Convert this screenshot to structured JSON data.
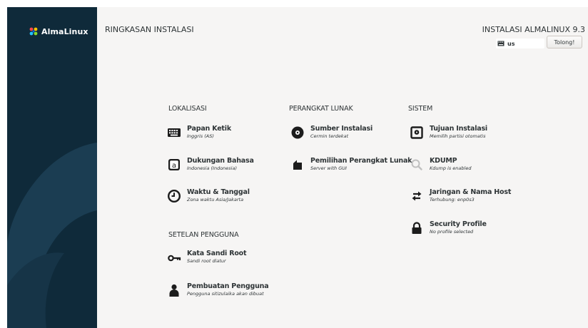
{
  "sidebar": {
    "logo_text": "AlmaLinux"
  },
  "header": {
    "page_title": "RINGKASAN INSTALASI",
    "product_title": "INSTALASI ALMALINUX 9.3",
    "keyboard_layout": "us",
    "help_label": "Tolong!"
  },
  "categories": {
    "localization": "LOKALISASI",
    "software": "PERANGKAT LUNAK",
    "system": "SISTEM",
    "user_settings": "SETELAN PENGGUNA"
  },
  "spokes": {
    "keyboard": {
      "name": "Papan Ketik",
      "status": "Inggris (AS)"
    },
    "language": {
      "name": "Dukungan Bahasa",
      "status": "Indonesia (Indonesia)"
    },
    "time": {
      "name": "Waktu & Tanggal",
      "status": "Zona waktu Asia/Jakarta"
    },
    "source": {
      "name": "Sumber Instalasi",
      "status": "Cermin terdekat"
    },
    "software": {
      "name": "Pemilihan Perangkat Lunak",
      "status": "Server with GUI"
    },
    "destination": {
      "name": "Tujuan Instalasi",
      "status": "Memilih partisi otomatis"
    },
    "kdump": {
      "name": "KDUMP",
      "status": "Kdump is enabled"
    },
    "network": {
      "name": "Jaringan & Nama Host",
      "status": "Terhubung: enp0s3"
    },
    "security": {
      "name": "Security Profile",
      "status": "No profile selected"
    },
    "root": {
      "name": "Kata Sandi Root",
      "status": "Sandi root diatur"
    },
    "user": {
      "name": "Pembuatan Pengguna",
      "status": "Pengguna sitizulaika akan dibuat"
    }
  },
  "colors": {
    "sidebar_bg": "#0f2a3a",
    "sidebar_accent": "#1b3d52",
    "content_bg": "#f6f5f4",
    "icon": "#1c1c1c"
  }
}
